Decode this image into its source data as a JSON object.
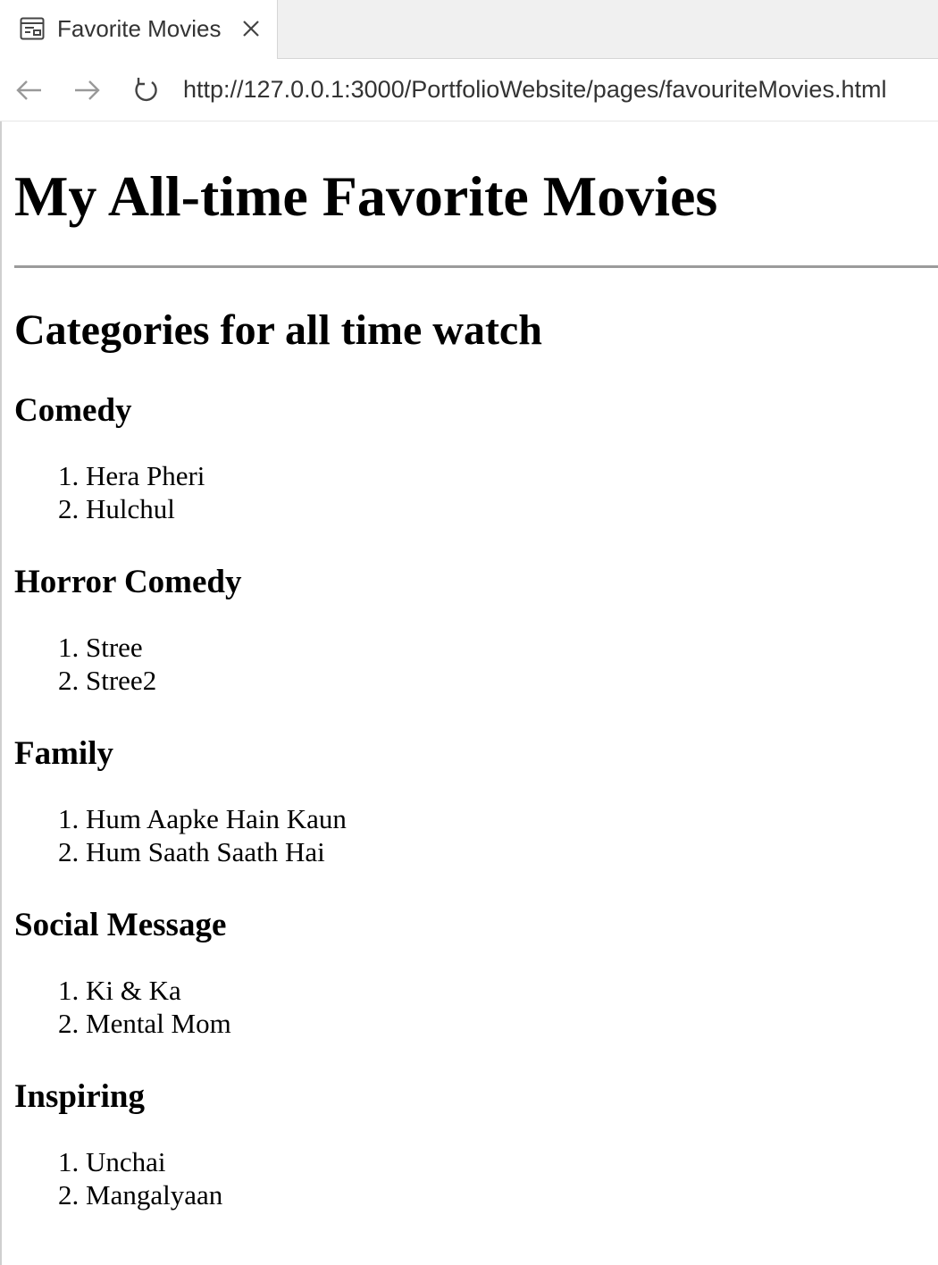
{
  "browser": {
    "tab_title": "Favorite Movies",
    "url": "http://127.0.0.1:3000/PortfolioWebsite/pages/favouriteMovies.html",
    "icons": {
      "tab": "page-icon",
      "close": "close-icon",
      "back": "arrow-left-icon",
      "forward": "arrow-right-icon",
      "reload": "reload-icon"
    }
  },
  "page": {
    "title": "My All-time Favorite Movies",
    "subtitle": "Categories for all time watch",
    "categories": [
      {
        "name": "Comedy",
        "movies": [
          "Hera Pheri",
          "Hulchul"
        ]
      },
      {
        "name": "Horror Comedy",
        "movies": [
          "Stree",
          "Stree2"
        ]
      },
      {
        "name": "Family",
        "movies": [
          "Hum Aapke Hain Kaun",
          "Hum Saath Saath Hai"
        ]
      },
      {
        "name": "Social Message",
        "movies": [
          "Ki & Ka",
          "Mental Mom"
        ]
      },
      {
        "name": "Inspiring",
        "movies": [
          "Unchai",
          "Mangalyaan"
        ]
      }
    ]
  }
}
